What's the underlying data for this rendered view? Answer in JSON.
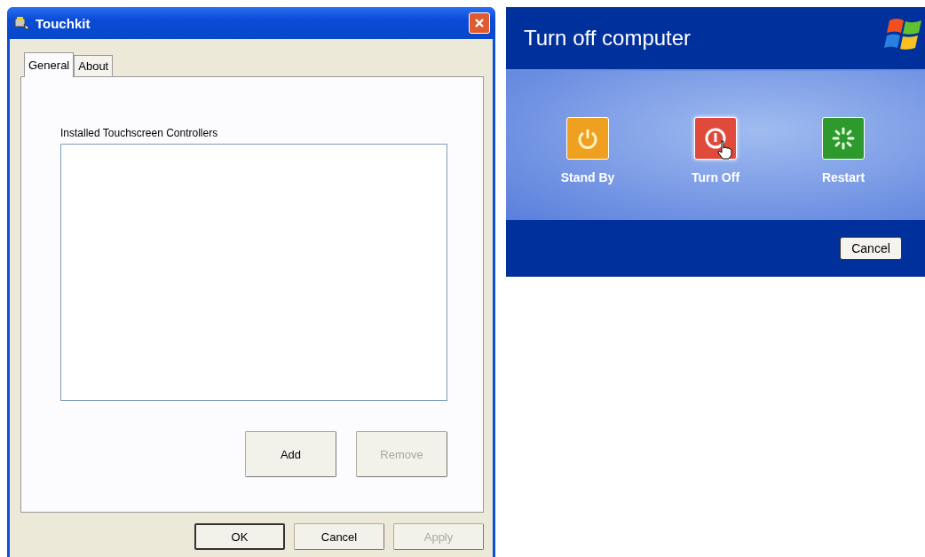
{
  "touchkit_window": {
    "title": "Touchkit",
    "tabs": [
      {
        "label": "General",
        "selected": true
      },
      {
        "label": "About",
        "selected": false
      }
    ],
    "list_label": "Installed Touchscreen Controllers",
    "list_buttons": [
      {
        "label": "Add",
        "disabled": false
      },
      {
        "label": "Remove",
        "disabled": true
      }
    ],
    "buttons": [
      {
        "label": "OK",
        "disabled": false,
        "default": true
      },
      {
        "label": "Cancel",
        "disabled": false,
        "default": false
      },
      {
        "label": "Apply",
        "disabled": true,
        "default": false
      }
    ]
  },
  "turn_off_dialog": {
    "title": "Turn off computer",
    "options": [
      {
        "kind": "standby",
        "label": "Stand By",
        "hovered": false
      },
      {
        "kind": "turnoff",
        "label": "Turn Off",
        "hovered": true
      },
      {
        "kind": "restart",
        "label": "Restart",
        "hovered": false
      }
    ],
    "cancel_button": "Cancel"
  }
}
